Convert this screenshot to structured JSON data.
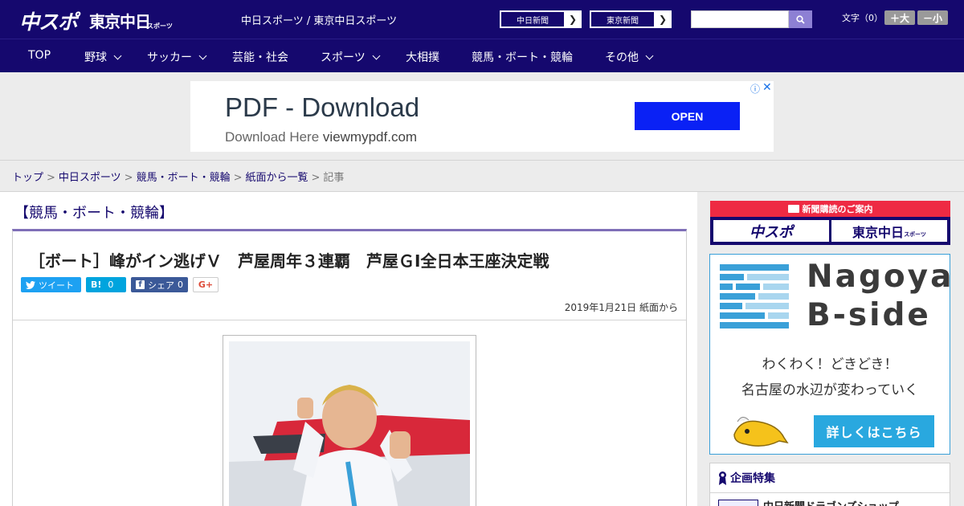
{
  "header": {
    "logo_main": "中スポ",
    "logo_tokyo": "東京中日",
    "logo_tokyo_sub": "スポーツ",
    "site_title": "中日スポーツ / 東京中日スポーツ",
    "chunichi_news": "中日新聞",
    "tokyo_news": "東京新聞",
    "search_placeholder": "",
    "font_label": "文字（0）",
    "font_bigger": "＋大",
    "font_smaller": "－小"
  },
  "nav": {
    "items": [
      {
        "label": "TOP",
        "has_dropdown": false
      },
      {
        "label": "野球",
        "has_dropdown": true
      },
      {
        "label": "サッカー",
        "has_dropdown": true
      },
      {
        "label": "芸能・社会",
        "has_dropdown": false
      },
      {
        "label": "スポーツ",
        "has_dropdown": true
      },
      {
        "label": "大相撲",
        "has_dropdown": false
      },
      {
        "label": "競馬・ボート・競輪",
        "has_dropdown": false
      },
      {
        "label": "その他",
        "has_dropdown": true
      }
    ]
  },
  "ad": {
    "title": "PDF - Download",
    "sub_prefix": "Download Here",
    "sub_domain": "viewmypdf.com",
    "open_label": "OPEN",
    "info_icon": "ⓘ",
    "close_icon": "✕"
  },
  "breadcrumb": {
    "items": [
      "トップ",
      "中日スポーツ",
      "競馬・ボート・競輪",
      "紙面から一覧"
    ],
    "current": "記事",
    "separator": ">"
  },
  "article": {
    "section": "【競馬・ボート・競輪】",
    "headline": "［ボート］峰がイン逃げＶ　芦屋周年３連覇　芦屋ＧⅠ全日本王座決定戦",
    "share": {
      "tweet_label": "ツイート",
      "hatena_label": "B!",
      "hatena_count": "0",
      "facebook_label": "シェア",
      "facebook_count": "0",
      "gplus_label": "G+"
    },
    "date": "2019年1月21日 紙面から"
  },
  "sidebar": {
    "subscribe_title": "新聞購読のご案内",
    "subscribe_chuspo": "中スポ",
    "subscribe_tokyo": "東京中日",
    "subscribe_tokyo_sub": "スポーツ",
    "bside_line1": "Nagoya",
    "bside_line2": "B-side",
    "bside_catch1": "わくわく！どきどき！",
    "bside_catch2": "名古屋の水辺が変わっていく",
    "bside_button": "詳しくはこちら",
    "kikaku_title": "企画特集",
    "kikaku_item": "中日新聞ドラゴンズショップ"
  },
  "colors": {
    "brand_navy": "#15086e",
    "accent_purple": "#7f6fb7",
    "ad_blue": "#0a21f5",
    "subscribe_red": "#ee2a43",
    "bside_blue": "#29a8df"
  }
}
